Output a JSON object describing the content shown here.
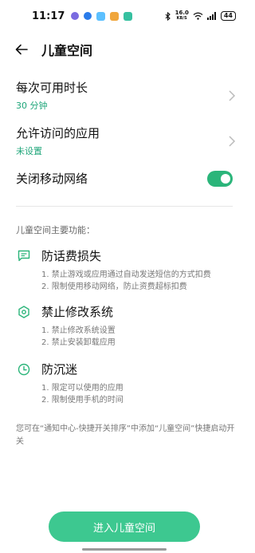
{
  "status": {
    "time": "11:17",
    "net_speed_value": "16.0",
    "net_speed_unit": "KB/S",
    "battery": "44"
  },
  "header": {
    "title": "儿童空间"
  },
  "settings": {
    "duration_label": "每次可用时长",
    "duration_value": "30 分钟",
    "apps_label": "允许访问的应用",
    "apps_value": "未设置",
    "network_label": "关闭移动网络",
    "network_toggle_on": true
  },
  "features": {
    "title": "儿童空间主要功能：",
    "items": [
      {
        "name": "防话费损失",
        "icon": "message-icon",
        "lines": [
          "1. 禁止游戏或应用通过自动发送短信的方式扣费",
          "2. 限制使用移动网络，防止资费超标扣费"
        ]
      },
      {
        "name": "禁止修改系统",
        "icon": "settings-hexagon-icon",
        "lines": [
          "1. 禁止修改系统设置",
          "2. 禁止安装卸载应用"
        ]
      },
      {
        "name": "防沉迷",
        "icon": "clock-icon",
        "lines": [
          "1. 限定可以使用的应用",
          "2. 限制使用手机的时间"
        ]
      }
    ]
  },
  "footer_note": "您可在“通知中心-快捷开关排序”中添加“儿童空间”快捷启动开关",
  "enter_button": "进入儿童空间",
  "colors": {
    "accent": "#2bb57a",
    "button": "#3dc890",
    "value_text": "#1fa67a"
  }
}
